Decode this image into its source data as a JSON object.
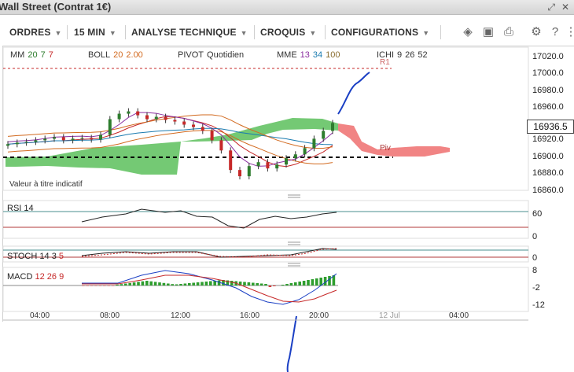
{
  "window": {
    "title": "Wall Street (Contrat 1€)"
  },
  "toolbar": {
    "orders": "ORDRES",
    "interval": "15 MIN",
    "analysis": "ANALYSE TECHNIQUE",
    "sketches": "CROQUIS",
    "configs": "CONFIGURATIONS"
  },
  "icons": [
    "layers-icon",
    "image-icon",
    "print-icon",
    "gear-icon",
    "help-icon",
    "close-icon",
    "fullscreen-icon"
  ],
  "legend": {
    "mm": {
      "label": "MM",
      "v1": "20",
      "v2": "7",
      "v3": "7"
    },
    "boll": {
      "label": "BOLL",
      "v1": "20",
      "v2": "2.00"
    },
    "pivot": {
      "label": "PIVOT",
      "v1": "Quotidien"
    },
    "mme": {
      "label": "MME",
      "v1": "13",
      "v2": "34",
      "v3": "100"
    },
    "ichi": {
      "label": "ICHI",
      "v1": "9",
      "v2": "26",
      "v3": "52"
    }
  },
  "annotation": "Valeur à titre indicatif",
  "pivot_tag": "Piv",
  "r1_tag": "R1",
  "current_price": "16936.5",
  "colors": {
    "up": "#2e7d2e",
    "down": "#c62828",
    "cloud_green": "#4caf50",
    "cloud_red": "#ef5350",
    "accent_blue": "#1a3fc4"
  },
  "chart_data": {
    "type": "line",
    "price_axis": [
      "17020.0",
      "17000.0",
      "16980.0",
      "16960.0",
      "16940.0",
      "16920.0",
      "16900.0",
      "16880.0",
      "16860.0"
    ],
    "time_axis": [
      "04:00",
      "08:00",
      "12:00",
      "16:00",
      "20:00",
      "12 Jul",
      "04:00"
    ],
    "ylim": [
      16855,
      17025
    ],
    "pivot_level": 16900,
    "close": [
      16913,
      16915,
      16916,
      16918,
      16920,
      16922,
      16918,
      16920,
      16921,
      16919,
      16925,
      16945,
      16952,
      16955,
      16950,
      16945,
      16948,
      16944,
      16942,
      16938,
      16935,
      16930,
      16918,
      16905,
      16880,
      16872,
      16885,
      16890,
      16882,
      16887,
      16895,
      16900,
      16908,
      16920,
      16930,
      16940
    ],
    "panels": [
      {
        "name": "RSI",
        "params": [
          "14"
        ],
        "ticks": [
          "60",
          "0"
        ]
      },
      {
        "name": "STOCH",
        "params": [
          "14",
          "3",
          "5"
        ],
        "ticks": [
          "0"
        ]
      },
      {
        "name": "MACD",
        "params": [
          "12",
          "26",
          "9"
        ],
        "ticks": [
          "8",
          "-2",
          "-12"
        ]
      }
    ]
  }
}
